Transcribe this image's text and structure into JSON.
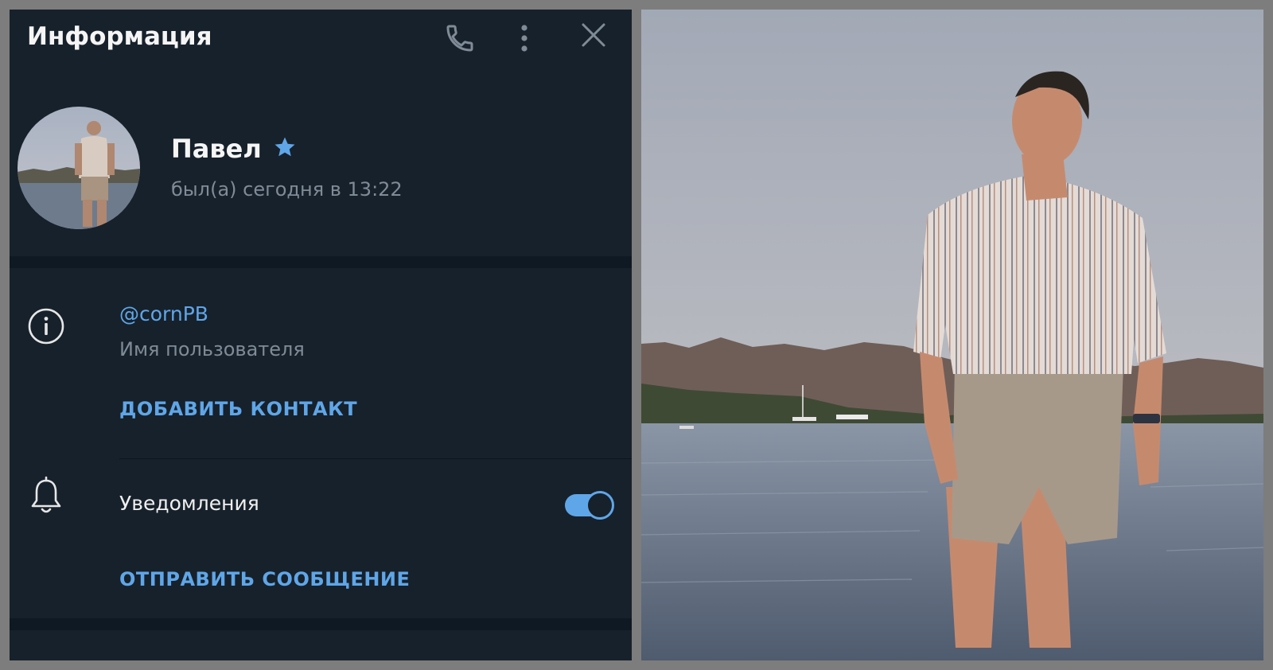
{
  "header": {
    "title": "Информация",
    "icons": [
      "phone-icon",
      "more-vertical-icon",
      "close-icon"
    ]
  },
  "profile": {
    "name": "Павел",
    "status": "был(а) сегодня в 13:22",
    "badge_icon": "star-icon"
  },
  "info": {
    "username": "@cornPB",
    "username_caption": "Имя пользователя",
    "add_contact_label": "ДОБАВИТЬ КОНТАКТ"
  },
  "notifications": {
    "label": "Уведомления",
    "enabled": true
  },
  "send_message_label": "ОТПРАВИТЬ СООБЩЕНИЕ",
  "colors": {
    "panel_bg": "#17212b",
    "accent": "#5fa6e8",
    "muted_text": "#7f8b97",
    "separator": "#0f1923"
  }
}
